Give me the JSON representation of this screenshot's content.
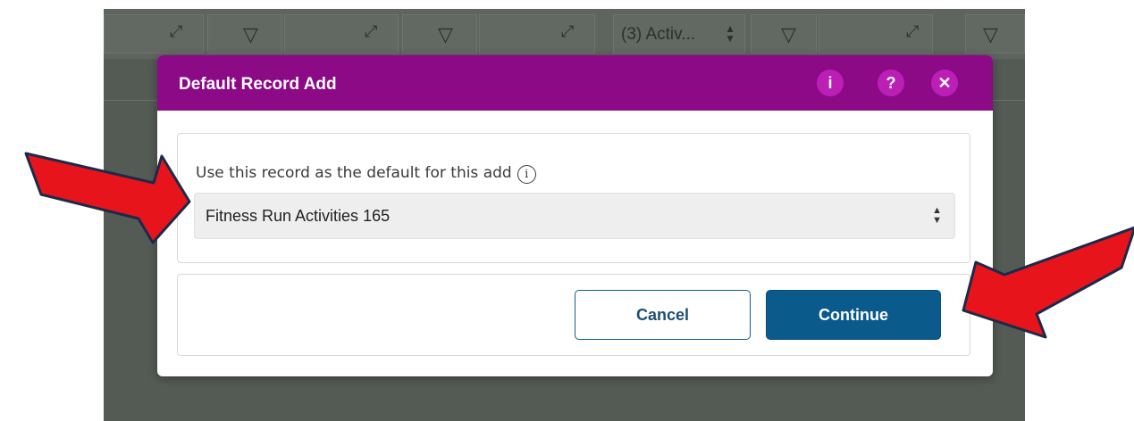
{
  "background_toolbar": {
    "select_text": "(3) Activ...",
    "filter_icon": "filter-icon",
    "expand_icon": "expand-icon"
  },
  "modal": {
    "title": "Default Record Add",
    "header_buttons": {
      "info": "i",
      "help": "?",
      "close": "✕"
    },
    "field": {
      "label": "Use this record as the default for this add",
      "info_glyph": "i",
      "selected_value": "Fitness Run Activities 165"
    },
    "buttons": {
      "cancel": "Cancel",
      "continue": "Continue"
    }
  },
  "colors": {
    "header": "#8c0a86",
    "header_button": "#bb1fb6",
    "primary_button": "#0b5a8c",
    "annotation_arrow": "#e8141c",
    "backdrop": "#545a54"
  }
}
